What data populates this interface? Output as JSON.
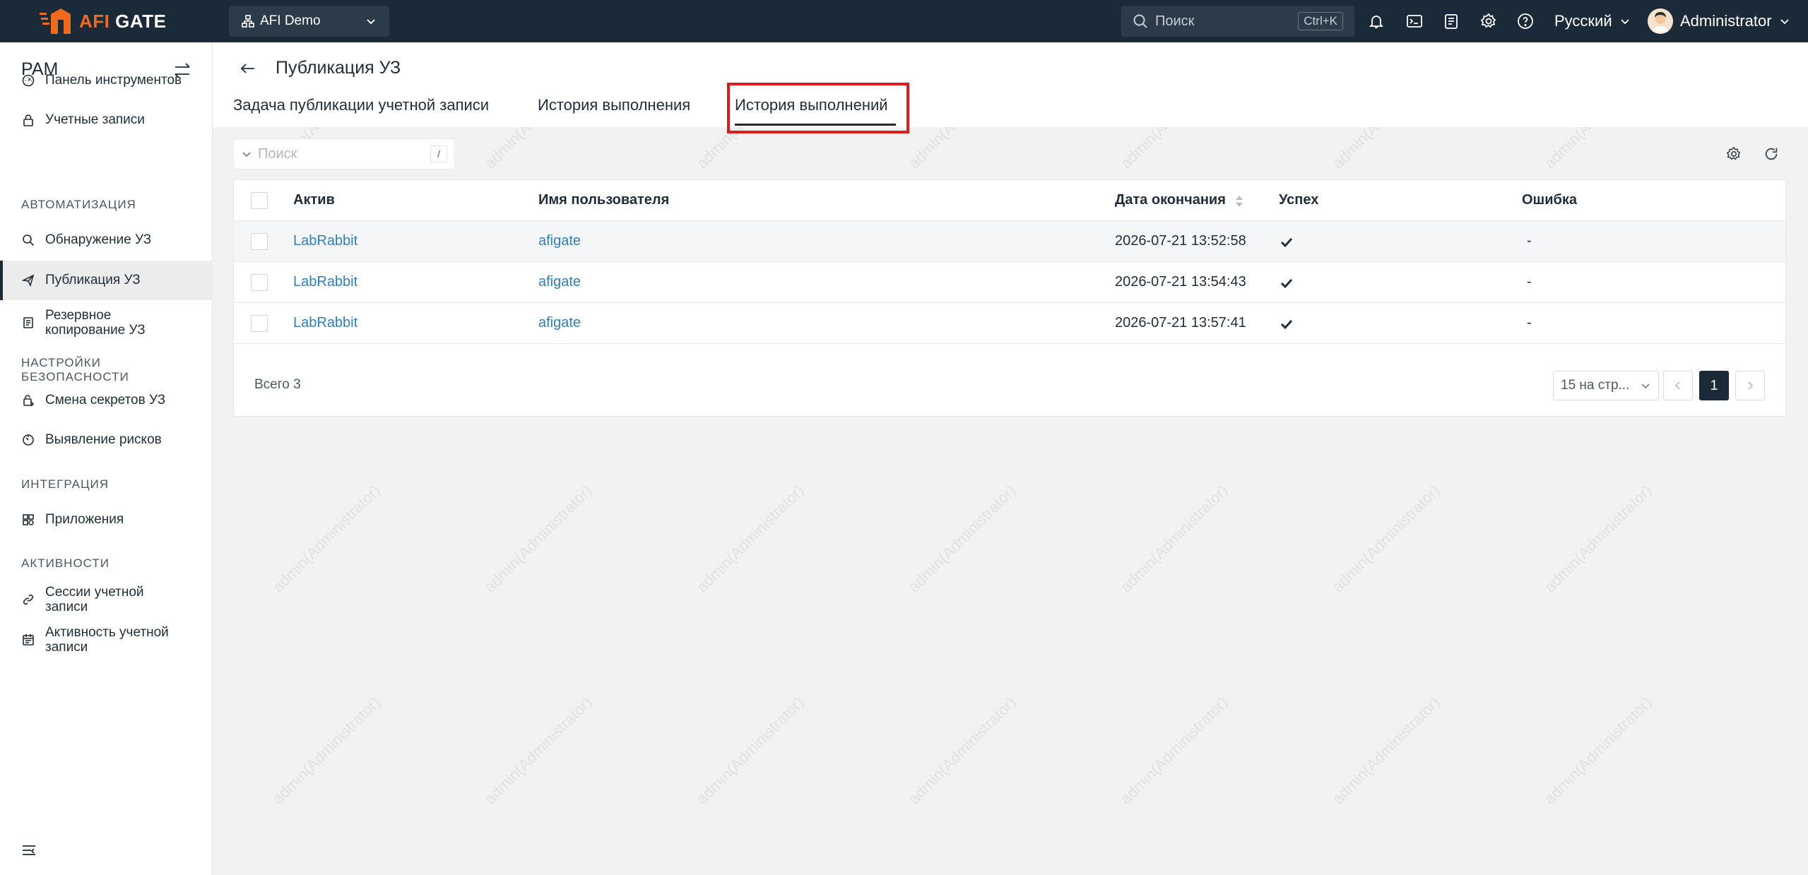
{
  "topbar": {
    "brand_prefix": "AFI",
    "brand_suffix": "GATE",
    "org_name": "AFI Demo",
    "search_placeholder": "Поиск",
    "search_shortcut": "Ctrl+K",
    "language": "Русский",
    "user_name": "Administrator",
    "brand_color": "#f06a1c"
  },
  "sidebar": {
    "title": "PAM",
    "items": [
      {
        "label": "Панель инструментов",
        "icon": "dashboard-icon"
      },
      {
        "label": "Учетные записи",
        "icon": "lock-icon"
      },
      {
        "label": "Обнаружение УЗ",
        "icon": "search-icon"
      },
      {
        "label": "Публикация УЗ",
        "icon": "send-icon"
      },
      {
        "label": "Резервное копирование УЗ",
        "icon": "backup-icon"
      },
      {
        "label": "Смена секретов УЗ",
        "icon": "secret-change-icon"
      },
      {
        "label": "Выявление рисков",
        "icon": "risk-icon"
      },
      {
        "label": "Приложения",
        "icon": "apps-icon"
      },
      {
        "label": "Сессии учетной записи",
        "icon": "link-icon"
      },
      {
        "label": "Активность учетной записи",
        "icon": "calendar-icon"
      }
    ],
    "sections": [
      "АВТОМАТИЗАЦИЯ",
      "НАСТРОЙКИ БЕЗОПАСНОСТИ",
      "ИНТЕГРАЦИЯ",
      "АКТИВНОСТИ"
    ],
    "active_item": "Публикация УЗ"
  },
  "page": {
    "title": "Публикация УЗ",
    "tabs": [
      "Задача публикации учетной записи",
      "История выполнения",
      "История выполнений"
    ],
    "active_tab": "История выполнений",
    "search_placeholder": "Поиск",
    "search_shortcut": "/"
  },
  "table": {
    "columns": [
      "Актив",
      "Имя пользователя",
      "Дата окончания",
      "Успех",
      "Ошибка"
    ],
    "rows": [
      {
        "asset": "LabRabbit",
        "user": "afigate",
        "date": "2026-07-21 13:52:58",
        "success": true,
        "error": "-"
      },
      {
        "asset": "LabRabbit",
        "user": "afigate",
        "date": "2026-07-21 13:54:43",
        "success": true,
        "error": "-"
      },
      {
        "asset": "LabRabbit",
        "user": "afigate",
        "date": "2026-07-21 13:57:41",
        "success": true,
        "error": "-"
      }
    ]
  },
  "pagination": {
    "total": "Всего 3",
    "per_page": "15 на стр...",
    "current_page": "1"
  },
  "watermark": "admin(Administrator)",
  "colors": {
    "topbar": "#1b2a38",
    "link": "#2f7fc1",
    "highlight": "#e01919"
  }
}
